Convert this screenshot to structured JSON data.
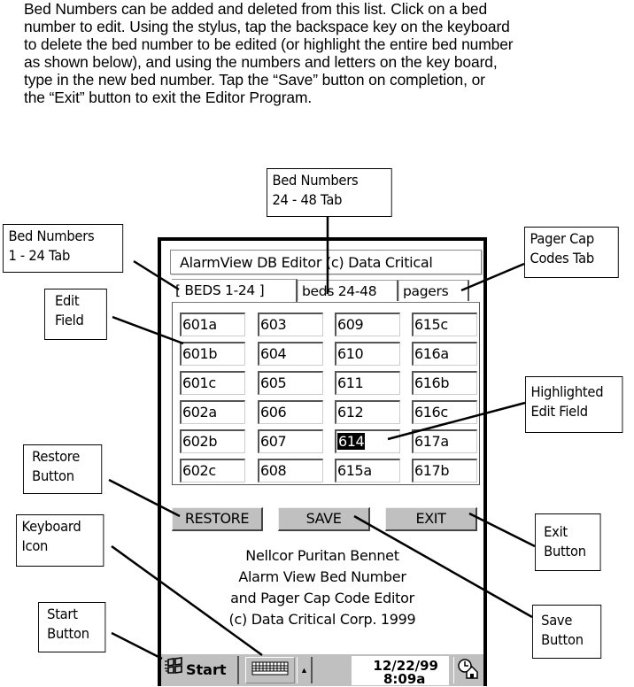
{
  "intro": {
    "lines": [
      "Bed Numbers can be added and deleted from this list.  Click on a bed",
      "number to edit.  Using the stylus, tap the backspace key on the keyboard",
      "to delete the bed number to be edited (or highlight the entire bed number",
      "as shown below), and using the numbers and letters on the key board,",
      "type in the new bed number.  Tap the “Save” button on completion, or",
      "the “Exit” button to exit the Editor Program."
    ]
  },
  "callouts": {
    "beds_24_48_tab": [
      "Bed Numbers",
      "24 - 48 Tab"
    ],
    "beds_1_24_tab": [
      "Bed Numbers",
      "1 - 24 Tab"
    ],
    "pager_tab": [
      "Pager Cap",
      "Codes Tab"
    ],
    "edit_field": [
      "Edit",
      "Field"
    ],
    "highlighted_field": [
      "Highlighted",
      "Edit Field"
    ],
    "restore_button": [
      "Restore",
      "Button"
    ],
    "keyboard_icon": [
      "Keyboard",
      "Icon"
    ],
    "start_button": [
      "Start",
      "Button"
    ],
    "exit_button": [
      "Exit",
      "Button"
    ],
    "save_button": [
      "Save",
      "Button"
    ]
  },
  "app": {
    "title": "AlarmView DB Editor (c) Data Critical",
    "tabs": [
      {
        "label": "[ BEDS 1-24 ]",
        "active": true
      },
      {
        "label": "beds 24-48",
        "active": false
      },
      {
        "label": "pagers",
        "active": false
      }
    ],
    "columns": [
      [
        "601a",
        "601b",
        "601c",
        "602a",
        "602b",
        "602c"
      ],
      [
        "603",
        "604",
        "605",
        "606",
        "607",
        "608"
      ],
      [
        "609",
        "610",
        "611",
        "612",
        "614",
        "615a"
      ],
      [
        "615c",
        "616a",
        "616b",
        "616c",
        "617a",
        "617b"
      ]
    ],
    "highlighted": "614",
    "buttons": {
      "restore": "RESTORE",
      "save": "SAVE",
      "exit": "EXIT"
    },
    "about": [
      "Nellcor Puritan Bennet",
      "Alarm View Bed Number",
      "and  Pager Cap Code Editor",
      "(c) Data Critical Corp. 1999"
    ]
  },
  "taskbar": {
    "start_label": "Start",
    "date": "12/22/99",
    "time": "8:09a",
    "icons": [
      "windows-flag-icon",
      "keyboard-icon",
      "up-arrow-icon",
      "clock-desktop-icon"
    ]
  }
}
